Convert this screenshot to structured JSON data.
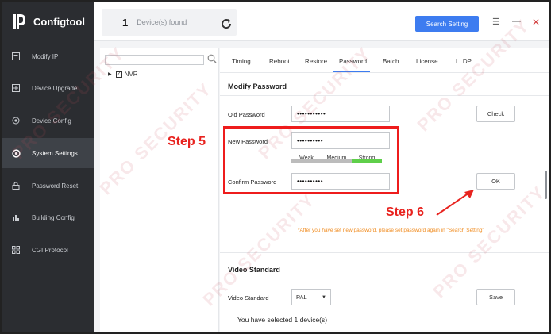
{
  "app": {
    "title": "Configtool"
  },
  "sidebar": {
    "items": [
      {
        "label": "Modify IP",
        "icon": "modify-ip-icon"
      },
      {
        "label": "Device Upgrade",
        "icon": "upgrade-icon"
      },
      {
        "label": "Device Config",
        "icon": "config-icon"
      },
      {
        "label": "System Settings",
        "icon": "settings-icon",
        "active": true
      },
      {
        "label": "Password Reset",
        "icon": "lock-icon"
      },
      {
        "label": "Building Config",
        "icon": "building-icon"
      },
      {
        "label": "CGI Protocol",
        "icon": "cgi-icon"
      }
    ]
  },
  "topbar": {
    "device_count": "1",
    "device_label": "Device(s) found",
    "search_setting_label": "Search Setting",
    "menu_glyph": "☰",
    "minimize_glyph": "—",
    "close_glyph": "✕"
  },
  "tree": {
    "search_placeholder": "",
    "node_label": "NVR",
    "checked": true
  },
  "tabs": [
    {
      "label": "Timing"
    },
    {
      "label": "Reboot"
    },
    {
      "label": "Restore"
    },
    {
      "label": "Password",
      "active": true
    },
    {
      "label": "Batch"
    },
    {
      "label": "License"
    },
    {
      "label": "LLDP"
    }
  ],
  "modify_password": {
    "title": "Modify Password",
    "old_label": "Old Password",
    "old_value": "•••••••••••",
    "check_label": "Check",
    "new_label": "New Password",
    "new_value": "••••••••••",
    "strength": {
      "weak": "Weak",
      "medium": "Medium",
      "strong": "Strong",
      "level": "strong"
    },
    "confirm_label": "Confirm Password",
    "confirm_value": "••••••••••",
    "ok_label": "OK",
    "hint": "*After you have set new password, please set password again in \"Search Setting\""
  },
  "video_standard": {
    "title": "Video Standard",
    "label": "Video Standard",
    "value": "PAL",
    "save_label": "Save"
  },
  "selected_note": "You have selected 1 device(s)",
  "annotations": {
    "step5": "Step 5",
    "step6": "Step 6",
    "color": "#e8231f"
  },
  "watermark": "PRO SECURITY",
  "colors": {
    "accent": "#3d7cf0",
    "sidebar": "#2b2d31",
    "strength_strong": "#5fcf4a",
    "hint": "#f08a1c"
  }
}
